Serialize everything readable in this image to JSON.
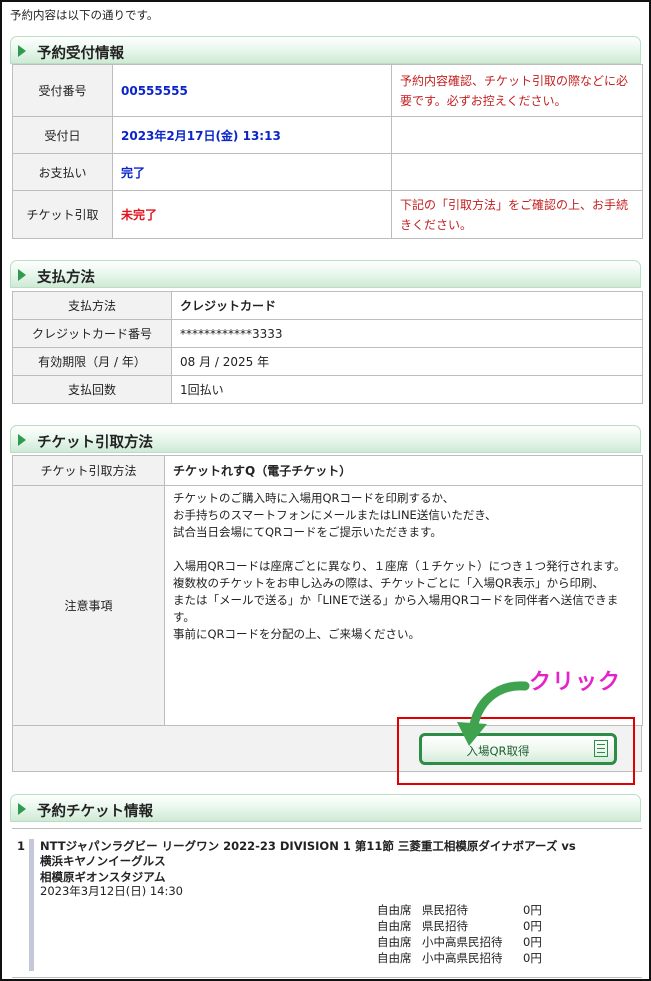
{
  "intro": "予約内容は以下の通りです。",
  "reservation": {
    "heading": "予約受付情報",
    "rows": [
      {
        "label": "受付番号",
        "value": "00555555",
        "note": "予約内容確認、チケット引取の際などに必要です。必ずお控えください。"
      },
      {
        "label": "受付日",
        "value": "2023年2月17日(金) 13:13",
        "note": ""
      },
      {
        "label": "お支払い",
        "value": "完了",
        "note": ""
      },
      {
        "label": "チケット引取",
        "value": "未完了",
        "note": "下記の「引取方法」をご確認の上、お手続きください。"
      }
    ],
    "colors": {
      "value_blue": "#0b25c9",
      "value_red": "#e0121c",
      "note_red": "#c21f1f"
    }
  },
  "payment": {
    "heading": "支払方法",
    "rows": [
      {
        "label": "支払方法",
        "value": "クレジットカード"
      },
      {
        "label": "クレジットカード番号",
        "value": "************3333"
      },
      {
        "label": "有効期限（月 / 年）",
        "value": "08 月 / 2025 年"
      },
      {
        "label": "支払回数",
        "value": "1回払い"
      }
    ]
  },
  "pickup": {
    "heading": "チケット引取方法",
    "method_label": "チケット引取方法",
    "method_value": "チケットれすQ（電子チケット）",
    "notes_label": "注意事項",
    "notes": [
      "チケットのご購入時に入場用QRコードを印刷するか、",
      "お手持ちのスマートフォンにメールまたはLINE送信いただき、",
      "試合当日会場にてQRコードをご提示いただきます。",
      "",
      "入場用QRコードは座席ごとに異なり、１座席（１チケット）につき１つ発行されます。",
      "複数枚のチケットをお申し込みの際は、チケットごとに「入場QR表示」から印刷、",
      "または「メールで送る」か「LINEで送る」から入場用QRコードを同伴者へ送信できます。",
      "事前にQRコードを分配の上、ご来場ください。"
    ],
    "qr_button_label": "入場QR取得",
    "qr_button_icon": "document-icon",
    "annotation": "クリック",
    "annotation_color": "#e623c8",
    "arrow_color": "#3ea24f",
    "highlight_color": "#e00000"
  },
  "tickets": {
    "heading": "予約チケット情報",
    "items": [
      {
        "index": "1",
        "event": "NTTジャパンラグビー リーグワン 2022-23 DIVISION 1 第11節 三菱重工相模原ダイナボアーズ vs 横浜キヤノンイーグルス",
        "venue": "相模原ギオンスタジアム",
        "datetime": "2023年3月12日(日) 14:30",
        "seats": [
          {
            "area": "自由席",
            "type": "県民招待",
            "price": "0円"
          },
          {
            "area": "自由席",
            "type": "県民招待",
            "price": "0円"
          },
          {
            "area": "自由席",
            "type": "小中高県民招待",
            "price": "0円"
          },
          {
            "area": "自由席",
            "type": "小中高県民招待",
            "price": "0円"
          }
        ]
      }
    ]
  },
  "theme": {
    "accent_green": "#2e9c4f",
    "border_gray": "#bdbdbd",
    "label_bg": "#f2f2f2"
  }
}
